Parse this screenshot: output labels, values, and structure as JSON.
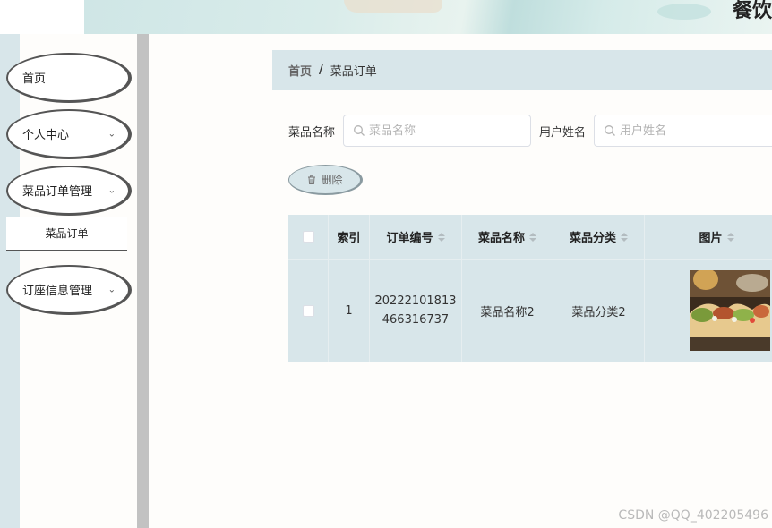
{
  "header": {
    "site_title": "餐饮"
  },
  "sidebar": {
    "items": [
      {
        "label": "首页"
      },
      {
        "label": "个人中心"
      },
      {
        "label": "菜品订单管理"
      },
      {
        "label": "订座信息管理"
      }
    ],
    "submenu": {
      "label": "菜品订单"
    }
  },
  "breadcrumb": {
    "home": "首页",
    "separator": "/",
    "current": "菜品订单"
  },
  "search": {
    "dish_label": "菜品名称",
    "dish_placeholder": "菜品名称",
    "user_label": "用户姓名",
    "user_placeholder": "用户姓名"
  },
  "toolbar": {
    "delete_label": "删除"
  },
  "table": {
    "columns": [
      "索引",
      "订单编号",
      "菜品名称",
      "菜品分类",
      "图片"
    ],
    "rows": [
      {
        "index": "1",
        "order_no_line1": "20222101813",
        "order_no_line2": "466316737",
        "dish_name": "菜品名称2",
        "dish_category": "菜品分类2"
      }
    ]
  },
  "watermark": "CSDN @QQ_402205496",
  "colors": {
    "accent_bg": "#d8e6ea",
    "divider": "#c2c2c2"
  }
}
